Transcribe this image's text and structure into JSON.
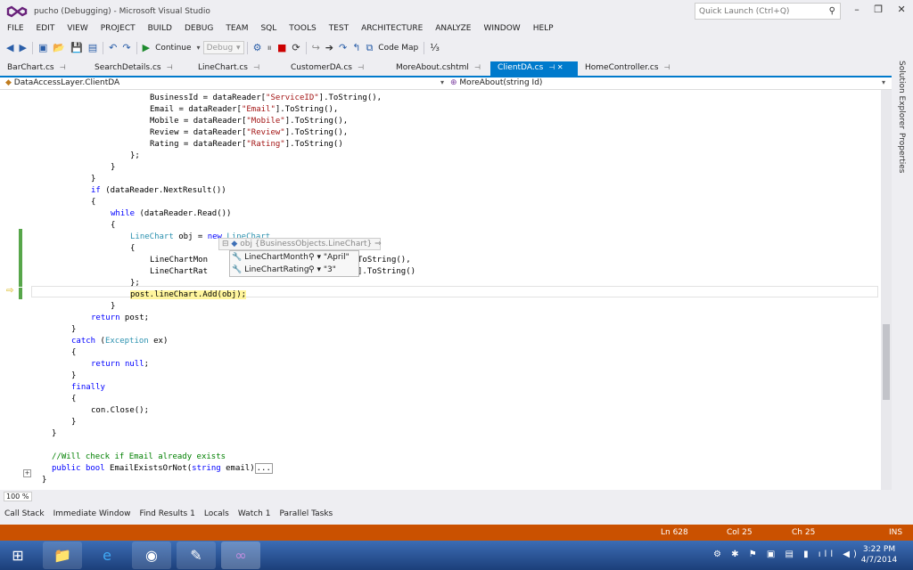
{
  "window": {
    "title": "pucho (Debugging) - Microsoft Visual Studio",
    "quick_launch": "Quick Launch (Ctrl+Q)"
  },
  "menu": [
    "FILE",
    "EDIT",
    "VIEW",
    "PROJECT",
    "BUILD",
    "DEBUG",
    "TEAM",
    "SQL",
    "TOOLS",
    "TEST",
    "ARCHITECTURE",
    "ANALYZE",
    "WINDOW",
    "HELP"
  ],
  "toolbar": {
    "continue": "Continue",
    "config": "Debug",
    "code_map": "Code Map"
  },
  "tabs": [
    {
      "label": "BarChart.cs",
      "active": false
    },
    {
      "label": "SearchDetails.cs",
      "active": false
    },
    {
      "label": "LineChart.cs",
      "active": false
    },
    {
      "label": "CustomerDA.cs",
      "active": false
    },
    {
      "label": "MoreAbout.cshtml",
      "active": false
    },
    {
      "label": "ClientDA.cs",
      "active": true
    },
    {
      "label": "HomeController.cs",
      "active": false
    }
  ],
  "nav": {
    "left": "DataAccessLayer.ClientDA",
    "right": "MoreAbout(string Id)"
  },
  "code": [
    {
      "indent": 22,
      "segs": [
        [
          "",
          "BusinessId = dataReader["
        ],
        [
          "st",
          "\"ServiceID\""
        ],
        [
          "",
          "].ToString(),"
        ]
      ]
    },
    {
      "indent": 22,
      "segs": [
        [
          "",
          "Email = dataReader["
        ],
        [
          "st",
          "\"Email\""
        ],
        [
          "",
          "].ToString(),"
        ]
      ]
    },
    {
      "indent": 22,
      "segs": [
        [
          "",
          "Mobile = dataReader["
        ],
        [
          "st",
          "\"Mobile\""
        ],
        [
          "",
          "].ToString(),"
        ]
      ]
    },
    {
      "indent": 22,
      "segs": [
        [
          "",
          "Review = dataReader["
        ],
        [
          "st",
          "\"Review\""
        ],
        [
          "",
          "].ToString(),"
        ]
      ]
    },
    {
      "indent": 22,
      "segs": [
        [
          "",
          "Rating = dataReader["
        ],
        [
          "st",
          "\"Rating\""
        ],
        [
          "",
          "].ToString()"
        ]
      ]
    },
    {
      "indent": 18,
      "segs": [
        [
          "",
          "};"
        ]
      ]
    },
    {
      "indent": 14,
      "segs": [
        [
          "",
          "}"
        ]
      ]
    },
    {
      "indent": 10,
      "segs": [
        [
          "",
          "}"
        ]
      ]
    },
    {
      "indent": 10,
      "segs": [
        [
          "kw",
          "if"
        ],
        [
          "",
          " (dataReader.NextResult())"
        ]
      ]
    },
    {
      "indent": 10,
      "segs": [
        [
          "",
          "{"
        ]
      ]
    },
    {
      "indent": 14,
      "segs": [
        [
          "kw",
          "while"
        ],
        [
          "",
          " (dataReader.Read())"
        ]
      ]
    },
    {
      "indent": 14,
      "segs": [
        [
          "",
          "{"
        ]
      ]
    },
    {
      "indent": 18,
      "segs": [
        [
          "ty",
          "LineChart"
        ],
        [
          "",
          " obj = "
        ],
        [
          "kw",
          "new"
        ],
        [
          "",
          " "
        ],
        [
          "ty",
          "LineChart"
        ]
      ]
    },
    {
      "indent": 18,
      "segs": [
        [
          "",
          "{"
        ]
      ]
    },
    {
      "indent": 22,
      "segs": [
        [
          "",
          "LineChartMon                      "
        ],
        [
          "st",
          "tMonth\""
        ],
        [
          "",
          "].ToString(),"
        ]
      ]
    },
    {
      "indent": 22,
      "segs": [
        [
          "",
          "LineChartRat                      "
        ],
        [
          "st",
          "rtRating\""
        ],
        [
          "",
          "].ToString()"
        ]
      ]
    },
    {
      "indent": 18,
      "segs": [
        [
          "",
          "};"
        ]
      ]
    },
    {
      "indent": 18,
      "segs": [
        [
          "hl",
          "post.lineChart.Add(obj);"
        ]
      ]
    },
    {
      "indent": 14,
      "segs": [
        [
          "",
          "}"
        ]
      ]
    },
    {
      "indent": 10,
      "segs": [
        [
          "kw",
          "return"
        ],
        [
          "",
          " post;"
        ]
      ]
    },
    {
      "indent": 6,
      "segs": [
        [
          "",
          "}"
        ]
      ]
    },
    {
      "indent": 6,
      "segs": [
        [
          "kw",
          "catch"
        ],
        [
          "",
          " ("
        ],
        [
          "ty",
          "Exception"
        ],
        [
          "",
          " ex)"
        ]
      ]
    },
    {
      "indent": 6,
      "segs": [
        [
          "",
          "{"
        ]
      ]
    },
    {
      "indent": 10,
      "segs": [
        [
          "kw",
          "return"
        ],
        [
          "",
          " "
        ],
        [
          "kw",
          "null"
        ],
        [
          "",
          ";"
        ]
      ]
    },
    {
      "indent": 6,
      "segs": [
        [
          "",
          "}"
        ]
      ]
    },
    {
      "indent": 6,
      "segs": [
        [
          "kw",
          "finally"
        ]
      ]
    },
    {
      "indent": 6,
      "segs": [
        [
          "",
          "{"
        ]
      ]
    },
    {
      "indent": 10,
      "segs": [
        [
          "",
          "con.Close();"
        ]
      ]
    },
    {
      "indent": 6,
      "segs": [
        [
          "",
          "}"
        ]
      ]
    },
    {
      "indent": 2,
      "segs": [
        [
          "",
          "}"
        ]
      ]
    },
    {
      "indent": 0,
      "segs": [
        [
          "",
          ""
        ]
      ]
    },
    {
      "indent": 2,
      "segs": [
        [
          "cm",
          "//Will check if Email already exists"
        ]
      ]
    },
    {
      "indent": 2,
      "segs": [
        [
          "kw",
          "public"
        ],
        [
          "",
          " "
        ],
        [
          "kw",
          "bool"
        ],
        [
          "",
          " EmailExistsOrNot("
        ],
        [
          "kw",
          "string"
        ],
        [
          "",
          " email)"
        ],
        [
          "box",
          "..."
        ]
      ]
    },
    {
      "indent": 0,
      "segs": [
        [
          "",
          "}"
        ]
      ]
    }
  ],
  "datatip": {
    "header": "obj {BusinessObjects.LineChart}",
    "rows": [
      {
        "name": "LineChartMonth",
        "value": "\"April\""
      },
      {
        "name": "LineChartRating",
        "value": "\"3\""
      }
    ]
  },
  "zoom": "100 %",
  "side_tabs": [
    "Solution Explorer",
    "Properties"
  ],
  "tool_windows": [
    "Call Stack",
    "Immediate Window",
    "Find Results 1",
    "Locals",
    "Watch 1",
    "Parallel Tasks"
  ],
  "status": {
    "ln": "Ln 628",
    "col": "Col 25",
    "ch": "Ch 25",
    "mode": "INS"
  },
  "clock": {
    "time": "3:22 PM",
    "date": "4/7/2014"
  },
  "colors": {
    "accent": "#007acc",
    "status_debug": "#ca5100"
  }
}
